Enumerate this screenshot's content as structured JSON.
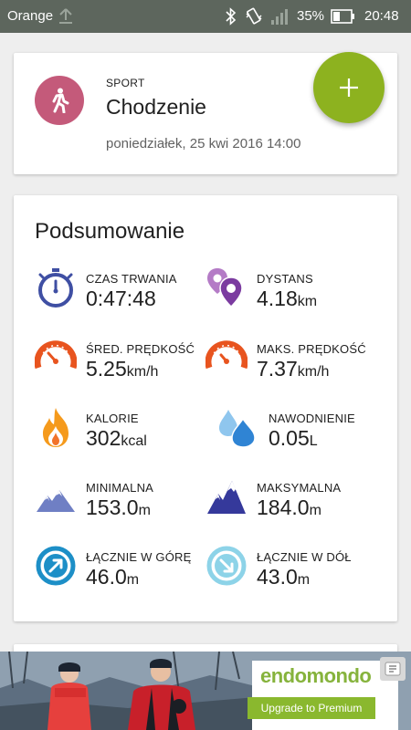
{
  "statusbar": {
    "carrier": "Orange",
    "battery": "35%",
    "time": "20:48"
  },
  "activity": {
    "sport_label": "SPORT",
    "sport_name": "Chodzenie",
    "datetime": "poniedziałek, 25 kwi 2016 14:00",
    "icon": "walking-person-icon",
    "avatar_color": "#c45a7a"
  },
  "fab": {
    "icon": "plus-icon",
    "color": "#8db21f"
  },
  "summary": {
    "title": "Podsumowanie",
    "stats": [
      {
        "label": "CZAS TRWANIA",
        "value": "0:47:48",
        "unit": "",
        "icon": "stopwatch-icon"
      },
      {
        "label": "DYSTANS",
        "value": "4.18",
        "unit": "km",
        "icon": "map-pins-icon"
      },
      {
        "label": "ŚRED. PRĘDKOŚĆ",
        "value": "5.25",
        "unit": "km/h",
        "icon": "speedometer-icon"
      },
      {
        "label": "MAKS. PRĘDKOŚĆ",
        "value": "7.37",
        "unit": "km/h",
        "icon": "speedometer-max-icon"
      },
      {
        "label": "KALORIE",
        "value": "302",
        "unit": "kcal",
        "icon": "flame-icon"
      },
      {
        "label": "NAWODNIENIE",
        "value": "0.05",
        "unit": "L",
        "icon": "water-drops-icon"
      },
      {
        "label": "MINIMALNA",
        "value": "153.0",
        "unit": "m",
        "icon": "mountain-low-icon"
      },
      {
        "label": "MAKSYMALNA",
        "value": "184.0",
        "unit": "m",
        "icon": "mountain-high-icon"
      },
      {
        "label": "ŁĄCZNIE W GÓRĘ",
        "value": "46.0",
        "unit": "m",
        "icon": "ascent-arrow-icon"
      },
      {
        "label": "ŁĄCZNIE W DÓŁ",
        "value": "43.0",
        "unit": "m",
        "icon": "descent-arrow-icon"
      }
    ]
  },
  "ad": {
    "brand": "endomondo",
    "button_label": "Upgrade to Premium",
    "brand_color": "#86b33c"
  }
}
